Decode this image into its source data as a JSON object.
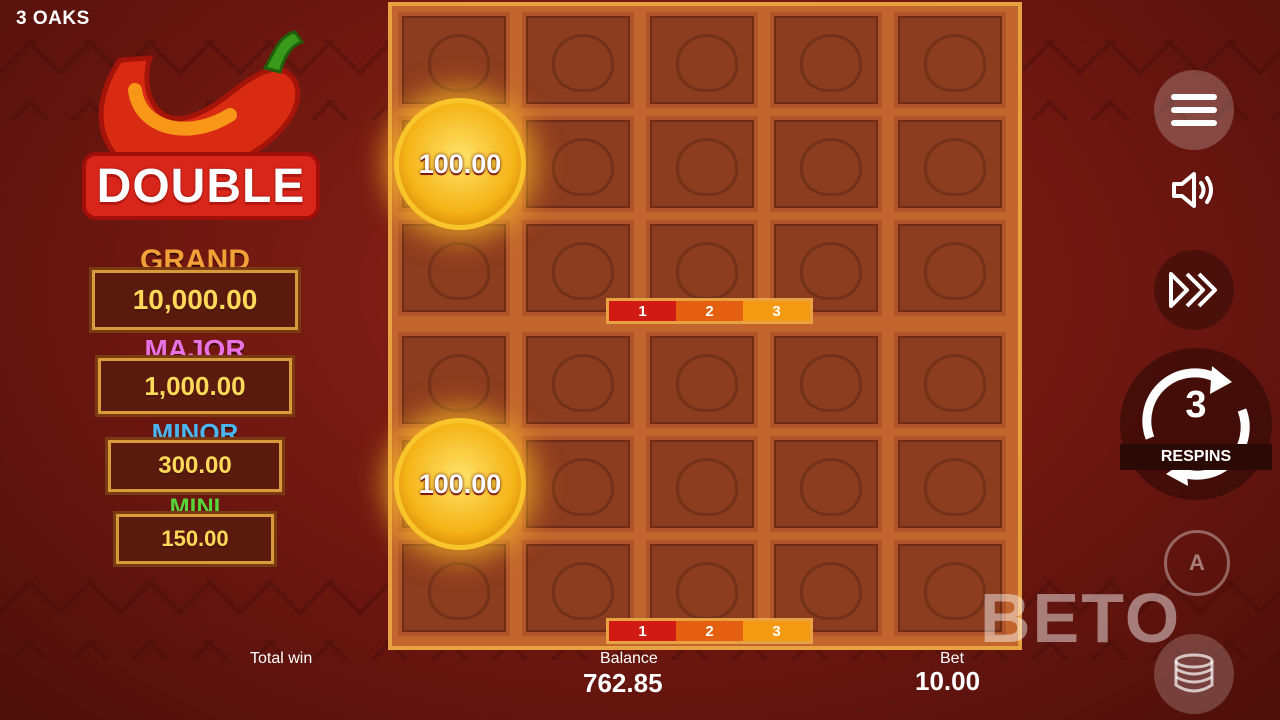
{
  "brand": "3 OAKS",
  "logo_text": "DOUBLE",
  "jackpots": [
    {
      "title": "GRAND",
      "value": "10,000.00",
      "color": "#f2a038"
    },
    {
      "title": "MAJOR",
      "value": "1,000.00",
      "color": "#e872e2"
    },
    {
      "title": "MINOR",
      "value": "300.00",
      "color": "#4bb6f0"
    },
    {
      "title": "MINI",
      "value": "150.00",
      "color": "#58d43a"
    }
  ],
  "meter_top": [
    "1",
    "2",
    "3"
  ],
  "meter_bottom": [
    "1",
    "2",
    "3"
  ],
  "coins": {
    "top_value": "100.00",
    "bottom_value": "100.00"
  },
  "respins": {
    "count": "3",
    "label": "RESPINS"
  },
  "footer": {
    "total_win_label": "Total win",
    "balance_label": "Balance",
    "balance_value": "762.85",
    "bet_label": "Bet",
    "bet_value": "10.00"
  },
  "watermark": "BETO"
}
